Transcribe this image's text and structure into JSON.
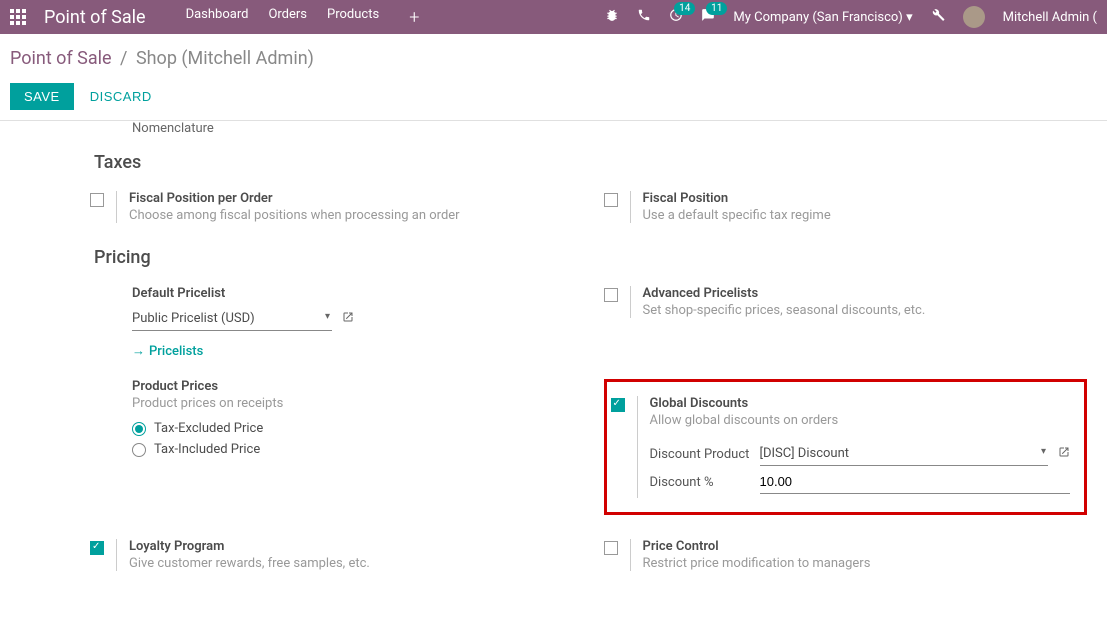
{
  "topbar": {
    "app_title": "Point of Sale",
    "nav": [
      "Dashboard",
      "Orders",
      "Products"
    ],
    "badge1": "14",
    "badge2": "11",
    "company": "My Company (San Francisco)",
    "user": "Mitchell Admin ("
  },
  "breadcrumb": {
    "root": "Point of Sale",
    "current": "Shop (Mitchell Admin)"
  },
  "actions": {
    "save": "SAVE",
    "discard": "DISCARD"
  },
  "trailing_field": "Nomenclature",
  "sections": {
    "taxes": {
      "title": "Taxes",
      "fiscal_per_order": {
        "title": "Fiscal Position per Order",
        "desc": "Choose among fiscal positions when processing an order"
      },
      "fiscal_position": {
        "title": "Fiscal Position",
        "desc": "Use a default specific tax regime"
      }
    },
    "pricing": {
      "title": "Pricing",
      "default_pricelist": {
        "label": "Default Pricelist",
        "value": "Public Pricelist (USD)",
        "link": "Pricelists"
      },
      "advanced_pricelists": {
        "title": "Advanced Pricelists",
        "desc": "Set shop-specific prices, seasonal discounts, etc."
      },
      "product_prices": {
        "title": "Product Prices",
        "desc": "Product prices on receipts",
        "option1": "Tax-Excluded Price",
        "option2": "Tax-Included Price"
      },
      "global_discounts": {
        "title": "Global Discounts",
        "desc": "Allow global discounts on orders",
        "discount_product_label": "Discount Product",
        "discount_product_value": "[DISC] Discount",
        "discount_pc_label": "Discount %",
        "discount_pc_value": "10.00"
      },
      "loyalty": {
        "title": "Loyalty Program",
        "desc": "Give customer rewards, free samples, etc."
      },
      "price_control": {
        "title": "Price Control",
        "desc": "Restrict price modification to managers"
      }
    }
  }
}
